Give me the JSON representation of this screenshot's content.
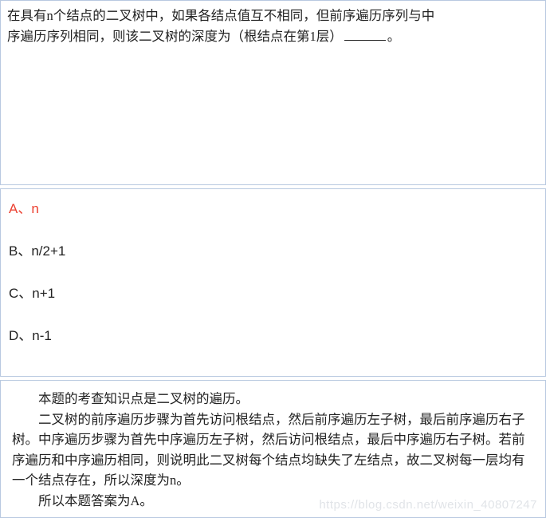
{
  "question": {
    "line1": "在具有n个结点的二叉树中，如果各结点值互不相同，但前序遍历序列与中",
    "line2_before": "序遍历序列相同，则该二叉树的深度为（根结点在第1层）",
    "line2_after": "。"
  },
  "options": {
    "a": "A、n",
    "b": "B、n/2+1",
    "c": "C、n+1",
    "d": "D、n-1"
  },
  "explanation": {
    "p1": "本题的考查知识点是二叉树的遍历。",
    "p2": "二叉树的前序遍历步骤为首先访问根结点，然后前序遍历左子树，最后前序遍历右子树。中序遍历步骤为首先中序遍历左子树，然后访问根结点，最后中序遍历右子树。若前序遍历和中序遍历相同，则说明此二叉树每个结点均缺失了左结点，故二叉树每一层均有一个结点存在，所以深度为n。",
    "p3": "所以本题答案为A。"
  },
  "watermark": "https://blog.csdn.net/weixin_40807247"
}
